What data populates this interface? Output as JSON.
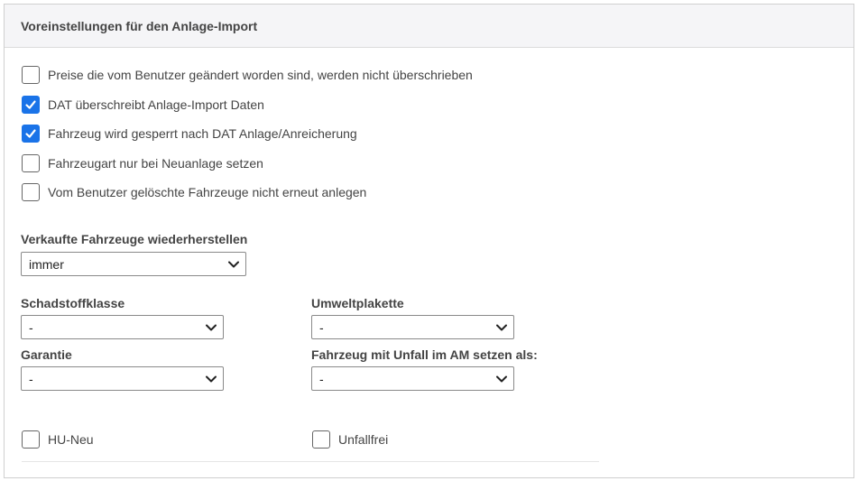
{
  "title": "Voreinstellungen für den Anlage-Import",
  "options": [
    {
      "label": "Preise die vom Benutzer geändert worden sind, werden nicht überschrieben",
      "checked": false
    },
    {
      "label": "DAT überschreibt Anlage-Import Daten",
      "checked": true
    },
    {
      "label": "Fahrzeug wird gesperrt nach DAT Anlage/Anreicherung",
      "checked": true
    },
    {
      "label": "Fahrzeugart nur bei Neuanlage setzen",
      "checked": false
    },
    {
      "label": "Vom Benutzer gelöschte Fahrzeuge nicht erneut anlegen",
      "checked": false
    }
  ],
  "restore": {
    "label": "Verkaufte Fahrzeuge wiederherstellen",
    "value": "immer"
  },
  "emission": {
    "label": "Schadstoffklasse",
    "value": "-"
  },
  "badge": {
    "label": "Umweltplakette",
    "value": "-"
  },
  "warranty": {
    "label": "Garantie",
    "value": "-"
  },
  "accident": {
    "label": "Fahrzeug mit Unfall im AM setzen als:",
    "value": "-"
  },
  "hu_neu": {
    "label": "HU-Neu",
    "checked": false
  },
  "unfallfrei": {
    "label": "Unfallfrei",
    "checked": false
  },
  "colors": {
    "accent": "#1a73e8",
    "border": "#cfcfcf",
    "header_bg": "#f5f5f7"
  }
}
